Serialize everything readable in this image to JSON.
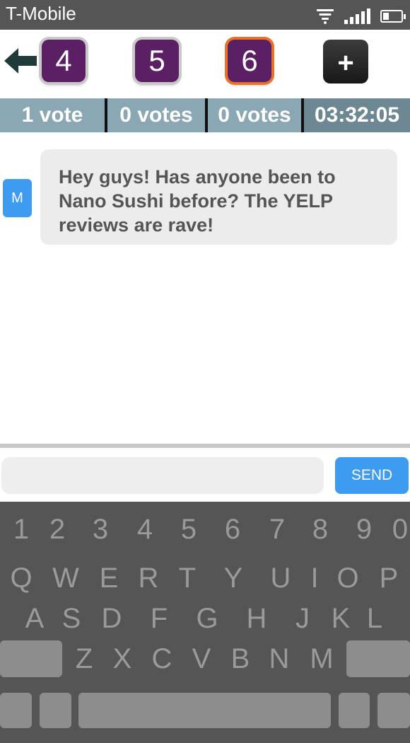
{
  "status_bar": {
    "carrier": "T-Mobile",
    "icons": [
      "wifi-icon",
      "signal-icon",
      "battery-icon"
    ]
  },
  "nav": {
    "back_icon": "arrow-left-icon",
    "options": [
      {
        "label": "4",
        "active": false
      },
      {
        "label": "5",
        "active": false
      },
      {
        "label": "6",
        "active": true
      }
    ],
    "add_label": "+"
  },
  "votes": {
    "cells": [
      "1 vote",
      "0 votes",
      "0 votes"
    ],
    "timer": "03:32:05"
  },
  "messages": [
    {
      "avatar": "M",
      "text": "Hey guys! Has anyone been to Nano Sushi before? The YELP reviews are rave!"
    }
  ],
  "composer": {
    "input_value": "",
    "send_label": "SEND"
  },
  "keyboard": {
    "numbers": [
      "1",
      "2",
      "3",
      "4",
      "5",
      "6",
      "7",
      "8",
      "9",
      "0"
    ],
    "row1": [
      "Q",
      "W",
      "E",
      "R",
      "T",
      "Y",
      "U",
      "I",
      "O",
      "P"
    ],
    "row2": [
      "A",
      "S",
      "D",
      "F",
      "G",
      "H",
      "J",
      "K",
      "L"
    ],
    "row3": [
      "Z",
      "X",
      "C",
      "V",
      "B",
      "N",
      "M"
    ]
  },
  "colors": {
    "tab_purple": "#5b1f63",
    "active_outline": "#e8722a",
    "vote_bar": "#8aa7b4",
    "accent_blue": "#3d9bf0",
    "keyboard_bg": "#555555"
  }
}
